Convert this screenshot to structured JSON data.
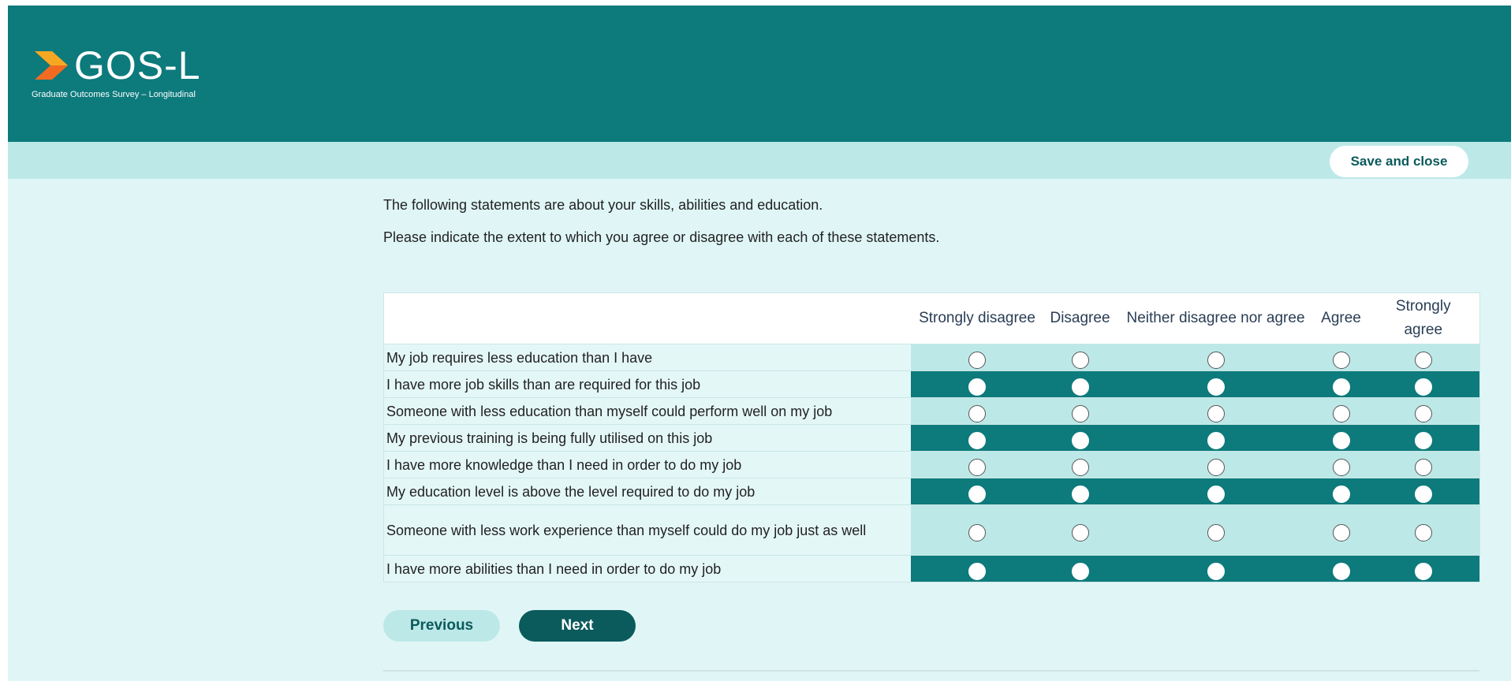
{
  "brand": {
    "logo_text": "GOS-L",
    "logo_subtitle": "Graduate Outcomes Survey – Longitudinal",
    "colors": {
      "header": "#0d7a7c",
      "subbar": "#bde8e8",
      "page": "#e0f6f6",
      "accent_orange": "#f26b21",
      "accent_yellow": "#f7a823"
    }
  },
  "toolbar": {
    "save_close_label": "Save and close"
  },
  "intro": {
    "line1": "The following statements are about your skills, abilities and education.",
    "line2": "Please indicate the extent to which you agree or disagree with each of these statements."
  },
  "scale": {
    "headers": [
      "Strongly disagree",
      "Disagree",
      "Neither disagree nor agree",
      "Agree",
      "Strongly agree"
    ]
  },
  "statements": [
    "My job requires less education than I have",
    "I have more job skills than are required for this job",
    "Someone with less education than myself could perform well on my job",
    "My previous training is being fully utilised on this job",
    "I have more knowledge than I need in order to do my job",
    "My education level is above the level required to do my job",
    "Someone with less work experience than myself could do my job just as well",
    "I have more abilities than I need in order to do my job"
  ],
  "nav": {
    "previous_label": "Previous",
    "next_label": "Next"
  }
}
